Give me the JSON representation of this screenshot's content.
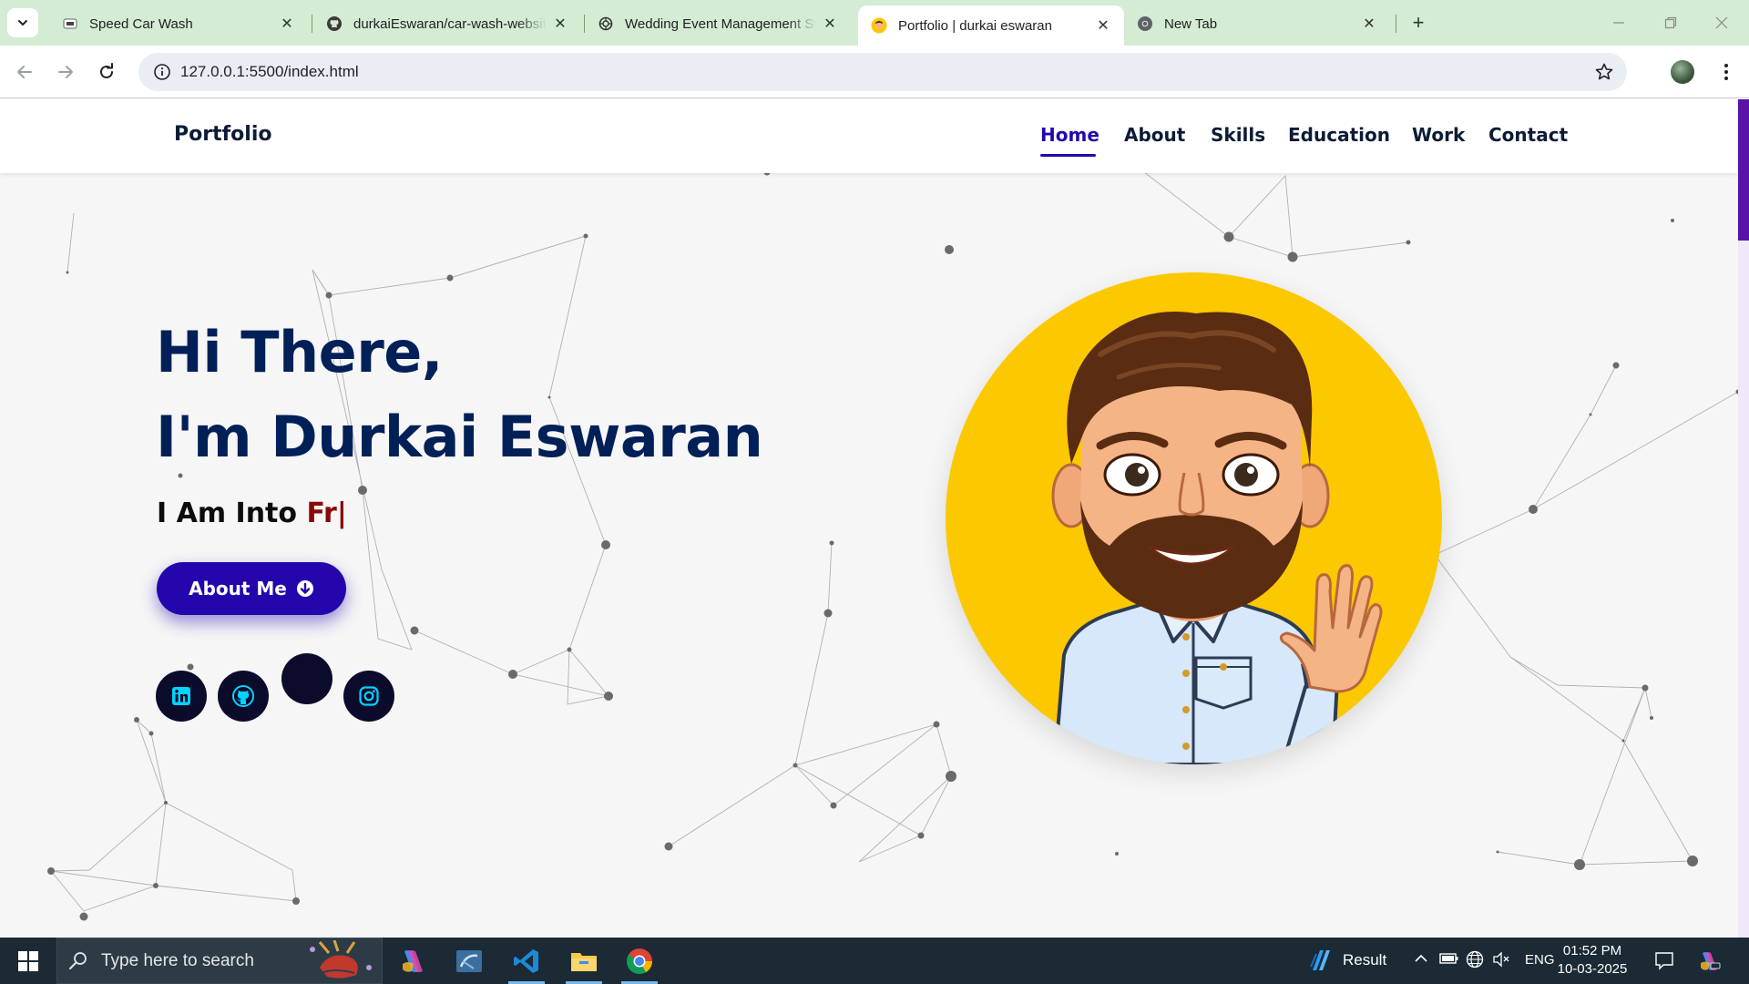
{
  "browser": {
    "tabs": [
      {
        "title": "Speed Car Wash",
        "icon": "car-wash-favicon-icon"
      },
      {
        "title": "durkaiEswaran/car-wash-website",
        "icon": "github-favicon-icon"
      },
      {
        "title": "Wedding Event Management Sys",
        "icon": "openai-favicon-icon"
      },
      {
        "title": "Portfolio | durkai eswaran",
        "icon": "avatar-favicon-icon"
      },
      {
        "title": "New Tab",
        "icon": "chrome-favicon-icon"
      }
    ],
    "active_tab_index": 3,
    "address_bar": {
      "url": "127.0.0.1:5500/index.html"
    },
    "icons": {
      "tab_search": "chevron-down-icon",
      "new_tab": "plus-icon",
      "back": "back-arrow-icon",
      "forward": "forward-arrow-icon",
      "reload": "reload-icon",
      "site_info": "info-icon",
      "bookmark": "star-icon",
      "menu": "vertical-dots-icon"
    },
    "colors": {
      "tab_strip": "#d3ecd3",
      "omnibox": "#e9eef4"
    }
  },
  "site": {
    "brand": "Portfolio",
    "nav": {
      "home": "Home",
      "about": "About",
      "skills": "Skills",
      "education": "Education",
      "work": "Work",
      "contact": "Contact"
    },
    "active_nav": "Home",
    "hero": {
      "line1": "Hi There,",
      "line2": "I'm Durkai Eswaran",
      "typing_prefix": "I Am Into ",
      "typing_text": "Fr",
      "cursor": "|",
      "button_label": "About Me",
      "button_icon": "arrow-circle-down-icon",
      "social_icons": [
        "linkedin-icon",
        "github-icon",
        "social-icon",
        "instagram-icon"
      ],
      "avatar": "bitmoji-avatar-waving"
    },
    "colors": {
      "heading": "#002057",
      "accent": "#2506ad",
      "typed": "#8b0707",
      "avatar_bg": "#fcc800",
      "social_bg": "#0b0b2c",
      "social_icon": "#00d4ff"
    }
  },
  "taskbar": {
    "search_placeholder": "Type here to search",
    "apps": [
      "copilot-icon",
      "ssms-icon",
      "vscode-icon",
      "file-explorer-icon",
      "chrome-icon"
    ],
    "weather_label": "Result",
    "language": "ENG",
    "time": "01:52 PM",
    "date": "10-03-2025",
    "tray_icons": [
      "chevron-up-icon",
      "battery-icon",
      "network-icon",
      "volume-muted-icon",
      "notification-icon",
      "copilot-icon"
    ]
  }
}
